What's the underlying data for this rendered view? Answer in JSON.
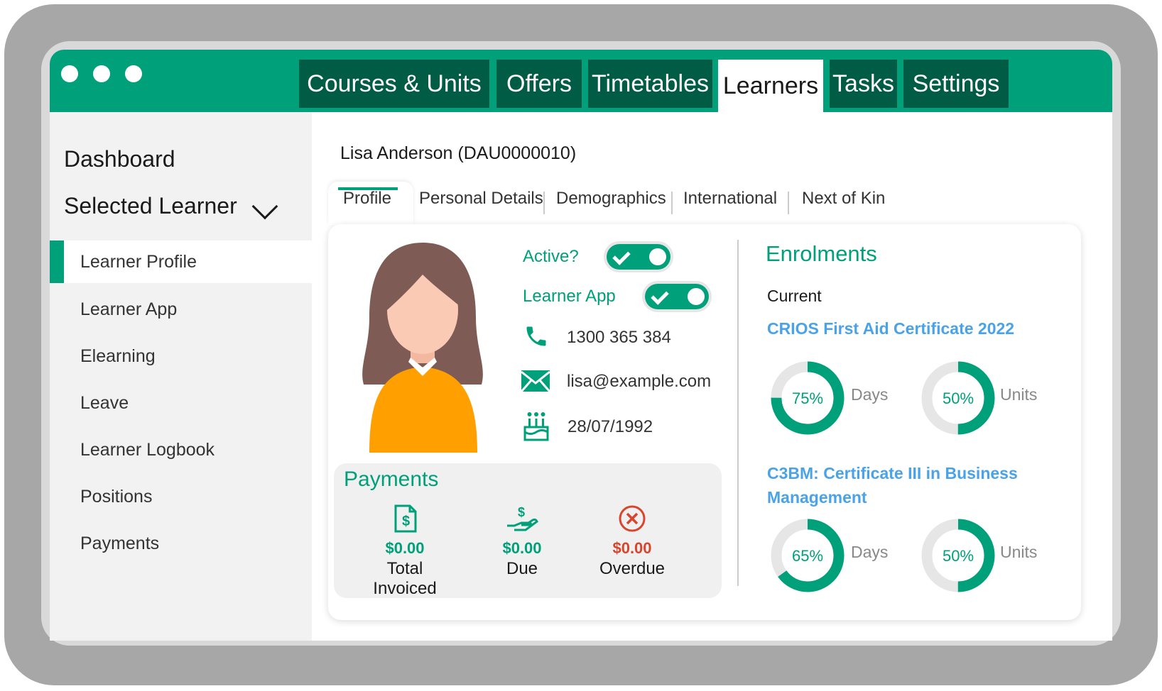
{
  "nav": {
    "tabs": [
      {
        "label": "Courses & Units"
      },
      {
        "label": "Offers"
      },
      {
        "label": "Timetables"
      },
      {
        "label": "Learners"
      },
      {
        "label": "Tasks"
      },
      {
        "label": "Settings"
      }
    ],
    "active_tab": "Learners"
  },
  "sidebar": {
    "dashboard": "Dashboard",
    "selected_learner": "Selected Learner",
    "items": [
      {
        "label": "Learner Profile"
      },
      {
        "label": "Learner App"
      },
      {
        "label": "Elearning"
      },
      {
        "label": "Leave"
      },
      {
        "label": "Learner Logbook"
      },
      {
        "label": "Positions"
      },
      {
        "label": "Payments"
      }
    ],
    "active_item": "Learner Profile"
  },
  "learner": {
    "title": "Lisa Anderson (DAU0000010)"
  },
  "subtabs": [
    {
      "label": "Profile"
    },
    {
      "label": "Personal Details"
    },
    {
      "label": "Demographics"
    },
    {
      "label": "International"
    },
    {
      "label": "Next of Kin"
    }
  ],
  "profile": {
    "active_label": "Active?",
    "active_on": true,
    "app_label": "Learner App",
    "app_on": true,
    "phone": "1300 365 384",
    "email": "lisa@example.com",
    "dob": "28/07/1992"
  },
  "payments": {
    "title": "Payments",
    "items": [
      {
        "amount": "$0.00",
        "label": "Total Invoiced",
        "icon": "invoice-icon"
      },
      {
        "amount": "$0.00",
        "label": "Due",
        "icon": "hand-dollar-icon"
      },
      {
        "amount": "$0.00",
        "label": "Overdue",
        "icon": "x-circle-icon"
      }
    ]
  },
  "enrolments": {
    "title": "Enrolments",
    "current_label": "Current",
    "courses": [
      {
        "name": "CRIOS First Aid Certificate 2022",
        "days_pct": 0.75,
        "days_text": "75%",
        "days_label": "Days",
        "units_pct": 0.5,
        "units_text": "50%",
        "units_label": "Units"
      },
      {
        "name": "C3BM: Certificate III in Business Management",
        "days_pct": 0.65,
        "days_text": "65%",
        "days_label": "Days",
        "units_pct": 0.5,
        "units_text": "50%",
        "units_label": "Units"
      }
    ]
  },
  "colors": {
    "brand": "#00a07a",
    "brand_dark": "#005c44",
    "link": "#4aa3e8",
    "overdue": "#d9452c",
    "ring_track": "#e6e6e6"
  }
}
